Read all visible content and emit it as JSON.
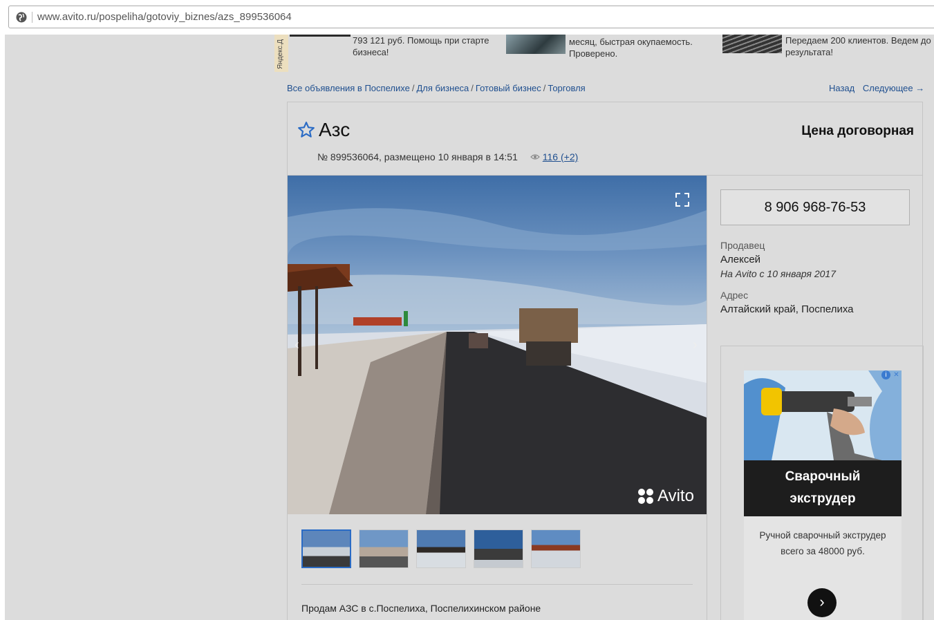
{
  "browser": {
    "url": "www.avito.ru/pospeliha/gotoviy_biznes/azs_899536064"
  },
  "top_ads": {
    "yandex_label": "Яндекс.Д",
    "items": [
      {
        "text": "793 121 руб. Помощь при старте бизнеса!"
      },
      {
        "text": "месяц, быстрая окупаемость. Проверено."
      },
      {
        "text": "Передаем 200 клиентов. Ведем до результата!"
      }
    ]
  },
  "breadcrumbs": {
    "items": [
      "Все объявления в Поспелихе",
      "Для бизнеса",
      "Готовый бизнес",
      "Торговля"
    ],
    "separator": "/"
  },
  "pager": {
    "back": "Назад",
    "next": "Следующее →"
  },
  "listing": {
    "title": "Азс",
    "price": "Цена договорная",
    "meta": "№ 899536064, размещено 10 января в 14:51",
    "views": "116 (+2)",
    "watermark": "Avito",
    "description": "Продам АЗС в с.Поспелиха, Поспелихинском районе"
  },
  "gallery": {
    "thumb_count": 5,
    "selected_index": 0
  },
  "contact": {
    "phone": "8 906 968-76-53",
    "seller_label": "Продавец",
    "seller_name": "Алексей",
    "seller_since": "На Avito с 10 января 2017",
    "address_label": "Адрес",
    "address": "Алтайский край, Поспелиха"
  },
  "side_ad": {
    "headline": "Сварочный экструдер",
    "headline_line1": "Сварочный",
    "headline_line2": "экструдер",
    "text": "Ручной сварочный экструдер всего за 48000 руб."
  },
  "colors": {
    "link": "#1f4f8f",
    "page_bg": "#dcdcdc",
    "accent_blue": "#2a6bc5"
  }
}
